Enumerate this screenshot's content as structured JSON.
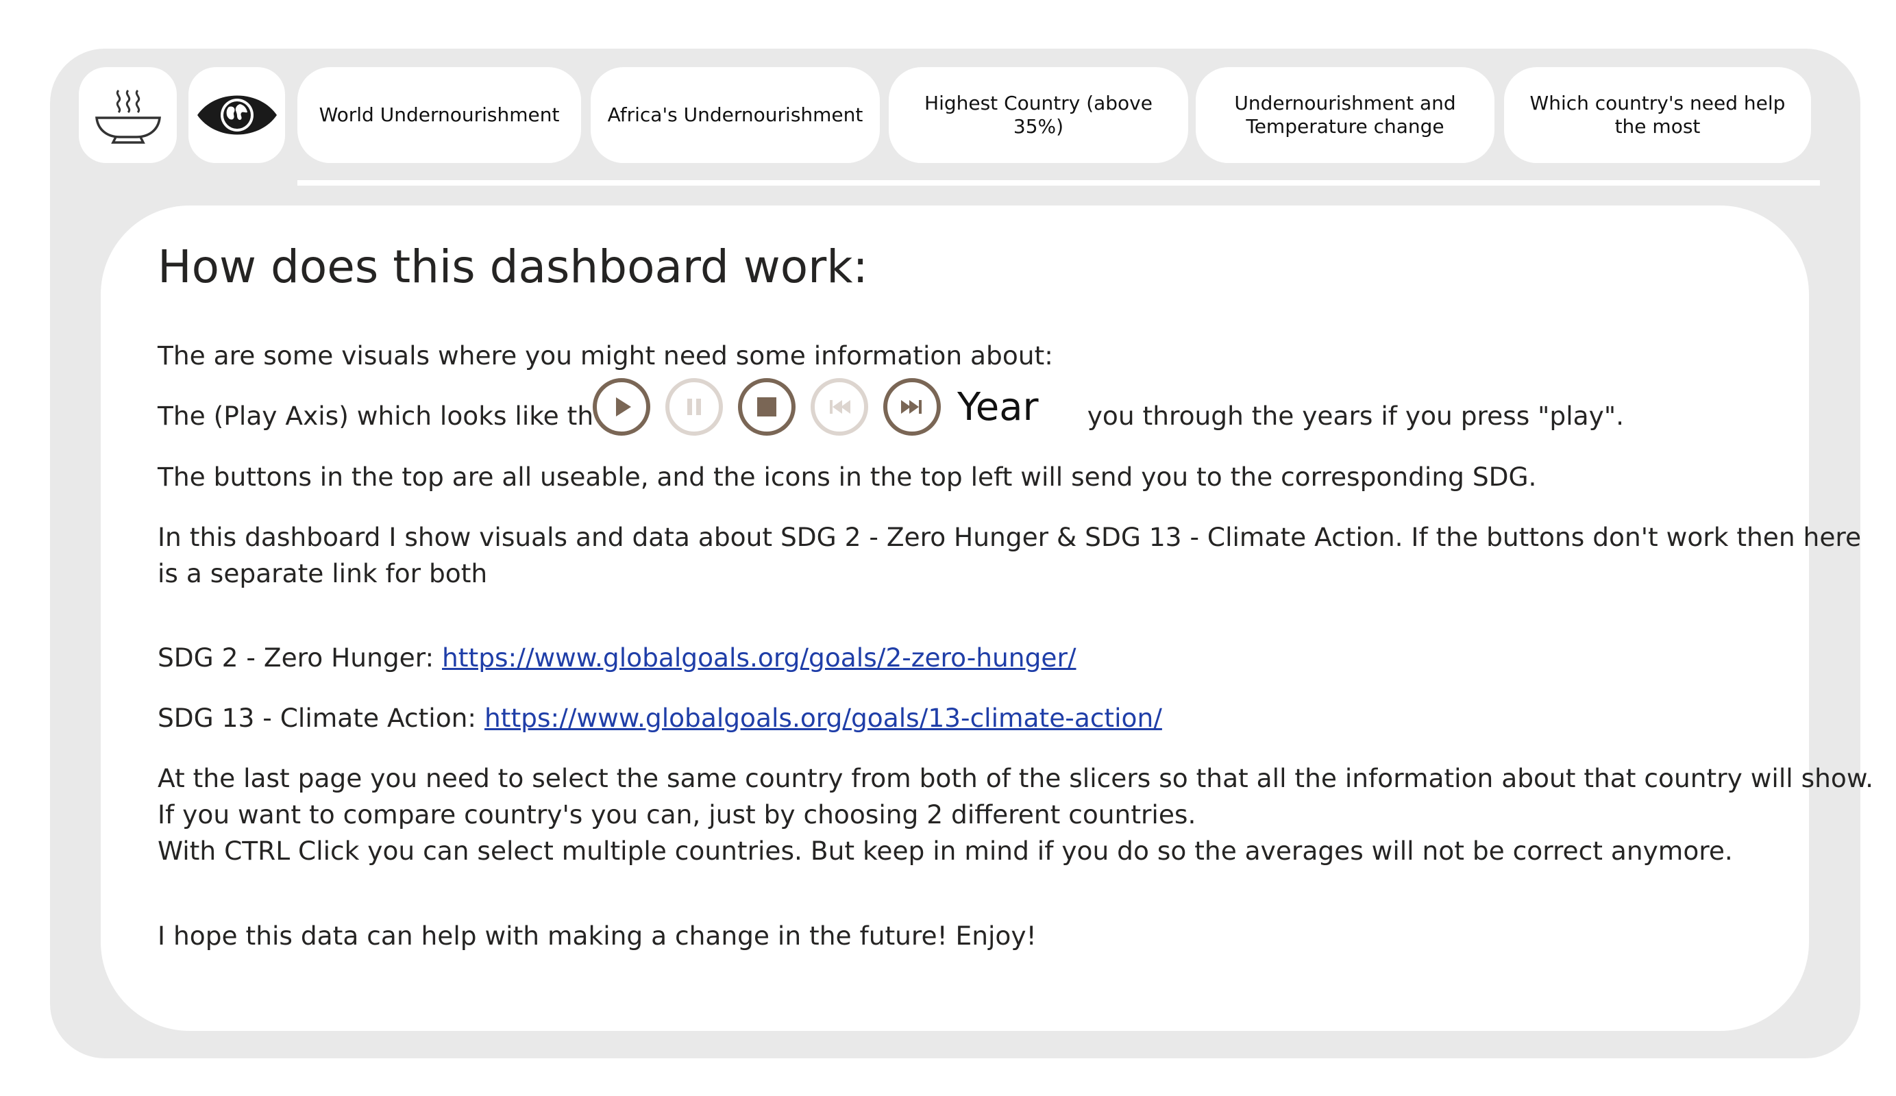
{
  "nav": {
    "icons": [
      "soup-bowl-icon",
      "earth-eye-icon"
    ],
    "buttons": [
      "World Undernourishment",
      "Africa's Undernourishment",
      "Highest Country (above 35%)",
      "Undernourishment and Temperature change",
      "Which country's need help the most"
    ]
  },
  "content": {
    "heading": "How does this dashboard work:",
    "intro": "The are some visuals where you might need some information about:",
    "play_axis_prefix": "The (Play Axis) which looks like this:",
    "play_axis_suffix": "you through the years if you press \"play\".",
    "buttons_text": "The buttons in the top are all useable, and the icons in the top left will send you to the corresponding SDG.",
    "sdg_text_line1": "In this dashboard I show visuals and data about SDG 2 - Zero Hunger & SDG 13 - Climate Action. If the buttons don't work then here",
    "sdg_text_line2": "is a separate link for both",
    "sdg2_label": "SDG 2 - Zero Hunger:",
    "sdg2_link": "https://www.globalgoals.org/goals/2-zero-hunger/",
    "sdg13_label": "SDG 13 - Climate Action:",
    "sdg13_link": "https://www.globalgoals.org/goals/13-climate-action/",
    "last_page_line1": "At the last page you need to select the same country from both of the slicers so that all the information about that country will show.",
    "last_page_line2": "If you want to compare country's you can, just by choosing 2 different countries.",
    "last_page_line3": "With CTRL Click you can select multiple countries. But keep in mind if you do so the averages will not be correct anymore.",
    "closing": "I hope this data can help with making a change in the future! Enjoy!"
  },
  "play_axis": {
    "buttons": [
      "play-icon",
      "pause-icon",
      "stop-icon",
      "skip-back-icon",
      "skip-forward-icon"
    ],
    "label": "Year",
    "active_color": "#7a6655",
    "disabled_color": "#ddd5cf"
  },
  "colors": {
    "frame": "#e9e9e9",
    "link": "#1f3ea8",
    "text": "#252423"
  }
}
